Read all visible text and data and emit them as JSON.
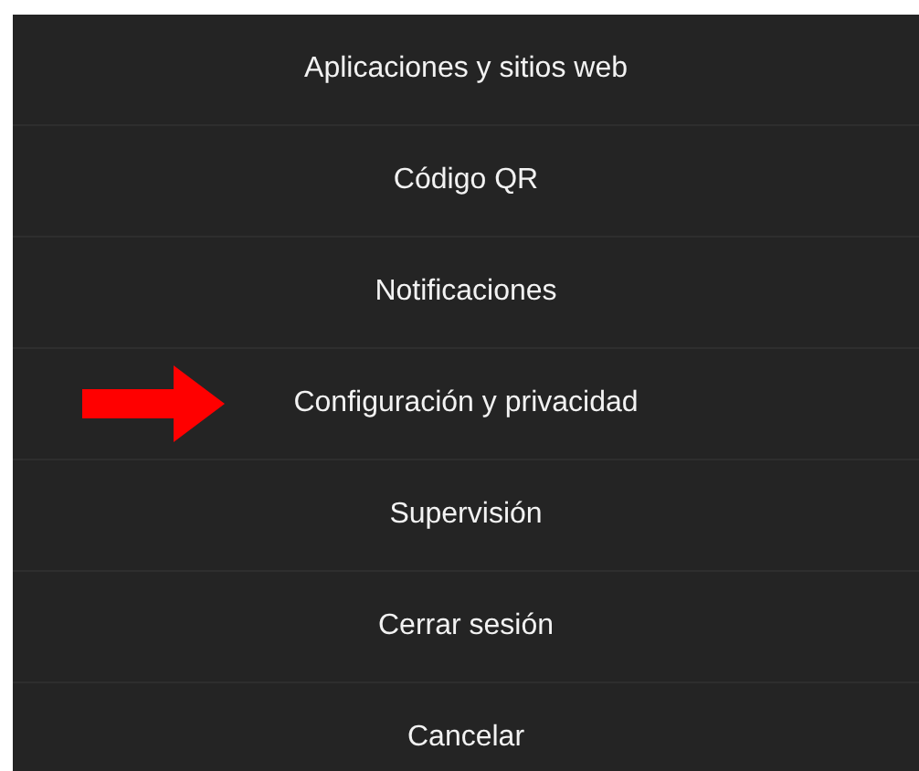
{
  "menu": {
    "items": [
      {
        "label": "Aplicaciones y sitios web",
        "marked": false
      },
      {
        "label": "Código QR",
        "marked": false
      },
      {
        "label": "Notificaciones",
        "marked": false
      },
      {
        "label": "Configuración y privacidad",
        "marked": true
      },
      {
        "label": "Supervisión",
        "marked": false
      },
      {
        "label": "Cerrar sesión",
        "marked": false
      },
      {
        "label": "Cancelar",
        "marked": false
      }
    ]
  }
}
